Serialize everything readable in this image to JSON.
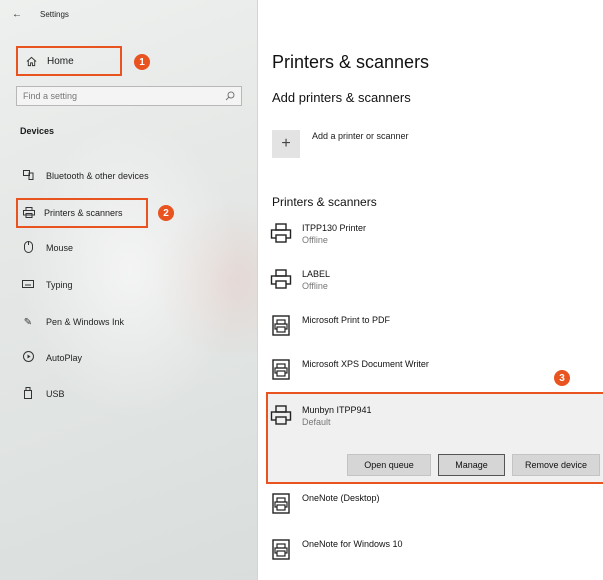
{
  "window": {
    "title": "Settings"
  },
  "sidebar": {
    "home_label": "Home",
    "search_placeholder": "Find a setting",
    "section_label": "Devices",
    "items": [
      {
        "label": "Bluetooth & other devices",
        "icon": "bluetooth-devices-icon"
      },
      {
        "label": "Printers & scanners",
        "icon": "printer-icon"
      },
      {
        "label": "Mouse",
        "icon": "mouse-icon"
      },
      {
        "label": "Typing",
        "icon": "keyboard-icon"
      },
      {
        "label": "Pen & Windows Ink",
        "icon": "pen-icon"
      },
      {
        "label": "AutoPlay",
        "icon": "autoplay-icon"
      },
      {
        "label": "USB",
        "icon": "usb-icon"
      }
    ]
  },
  "main": {
    "title": "Printers & scanners",
    "add_heading": "Add printers & scanners",
    "add_label": "Add a printer or scanner",
    "list_heading": "Printers & scanners",
    "devices": [
      {
        "name": "ITPP130 Printer",
        "status": "Offline",
        "icon": "printer-icon"
      },
      {
        "name": "LABEL",
        "status": "Offline",
        "icon": "printer-icon"
      },
      {
        "name": "Microsoft Print to PDF",
        "status": "",
        "icon": "document-printer-icon"
      },
      {
        "name": "Microsoft XPS Document Writer",
        "status": "",
        "icon": "document-printer-icon"
      },
      {
        "name": "Munbyn ITPP941",
        "status": "Default",
        "icon": "printer-icon"
      },
      {
        "name": "OneNote (Desktop)",
        "status": "",
        "icon": "document-printer-icon"
      },
      {
        "name": "OneNote for Windows 10",
        "status": "",
        "icon": "document-printer-icon"
      }
    ],
    "actions": {
      "open_queue": "Open queue",
      "manage": "Manage",
      "remove": "Remove device"
    }
  },
  "callouts": [
    "1",
    "2",
    "3"
  ],
  "colors": {
    "accent": "#e8531f",
    "panel": "#f0f0f0"
  }
}
